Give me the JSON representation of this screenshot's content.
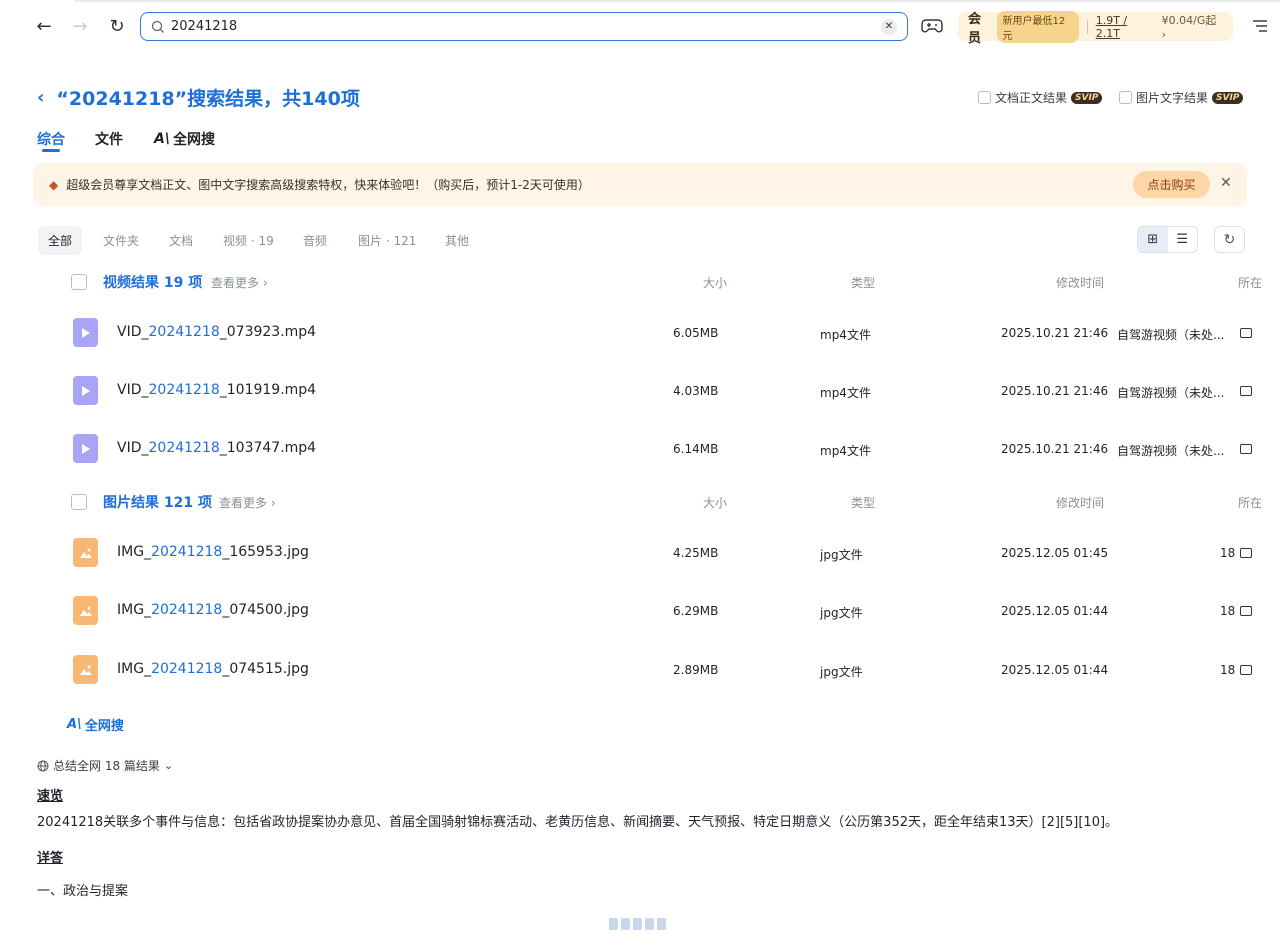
{
  "search": {
    "value": "20241218"
  },
  "vip": {
    "title": "会员",
    "badge": "新用户最低12元",
    "storage": "1.9T / 2.1T",
    "price": "¥0.04/G起 ›"
  },
  "header": {
    "title": "“20241218”搜索结果，共140项",
    "opt_doc": "文档正文结果",
    "opt_img": "图片文字结果",
    "svip": "SVIP"
  },
  "tabs": [
    "综合",
    "文件",
    "全网搜"
  ],
  "banner": {
    "text": "超级会员尊享文档正文、图中文字搜索高级搜索特权，快来体验吧！（购买后，预计1-2天可使用）",
    "buy": "点击购买"
  },
  "filters": [
    "全部",
    "文件夹",
    "文档",
    "视频 · 19",
    "音频",
    "图片 · 121",
    "其他"
  ],
  "columns": {
    "size": "大小",
    "type": "类型",
    "mtime": "修改时间",
    "loc": "所在"
  },
  "video_section": {
    "title": "视频结果 19 项",
    "more": "查看更多 ›",
    "rows": [
      {
        "prefix": "VID_",
        "hl": "20241218",
        "suffix": "_073923.mp4",
        "size": "6.05MB",
        "type": "mp4文件",
        "mtime": "2025.10.21 21:46",
        "loc": "自驾游视频（未处..."
      },
      {
        "prefix": "VID_",
        "hl": "20241218",
        "suffix": "_101919.mp4",
        "size": "4.03MB",
        "type": "mp4文件",
        "mtime": "2025.10.21 21:46",
        "loc": "自驾游视频（未处..."
      },
      {
        "prefix": "VID_",
        "hl": "20241218",
        "suffix": "_103747.mp4",
        "size": "6.14MB",
        "type": "mp4文件",
        "mtime": "2025.10.21 21:46",
        "loc": "自驾游视频（未处..."
      }
    ]
  },
  "image_section": {
    "title": "图片结果 121 项",
    "more": "查看更多 ›",
    "rows": [
      {
        "prefix": "IMG_",
        "hl": "20241218",
        "suffix": "_165953.jpg",
        "size": "4.25MB",
        "type": "jpg文件",
        "mtime": "2025.12.05 01:45",
        "loc": "18"
      },
      {
        "prefix": "IMG_",
        "hl": "20241218",
        "suffix": "_074500.jpg",
        "size": "6.29MB",
        "type": "jpg文件",
        "mtime": "2025.12.05 01:44",
        "loc": "18"
      },
      {
        "prefix": "IMG_",
        "hl": "20241218",
        "suffix": "_074515.jpg",
        "size": "2.89MB",
        "type": "jpg文件",
        "mtime": "2025.12.05 01:44",
        "loc": "18"
      }
    ]
  },
  "ai": {
    "label": "全网搜",
    "summary": "总结全网 18 篇结果",
    "overview_label": "速览",
    "overview": "20241218关联多个事件与信息：包括省政协提案协办意见、首届全国骑射锦标赛活动、老黄历信息、新闻摘要、天气预报、特定日期意义（公历第352天，距全年结束13天）[2][5][10]。",
    "detail_label": "详答",
    "section1": "一、政治与提案"
  }
}
